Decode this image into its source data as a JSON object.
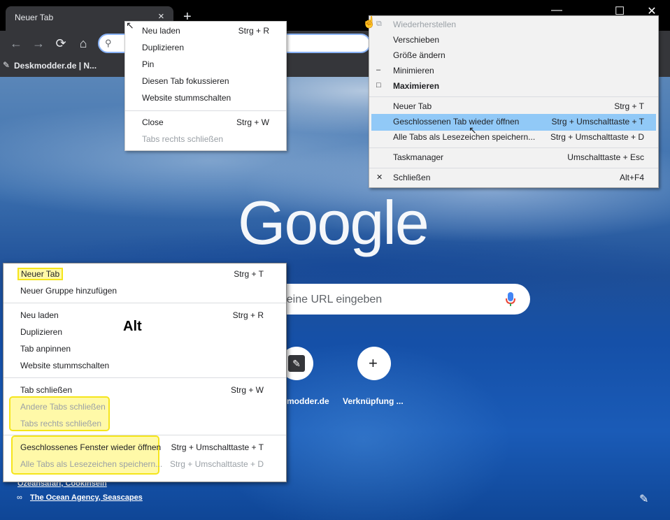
{
  "tab": {
    "title": "Neuer Tab",
    "close": "×",
    "new_tab": "+"
  },
  "window_controls": {
    "minimize": "—",
    "maximize": "☐",
    "close": "✕"
  },
  "toolbar": {
    "back": "←",
    "forward": "→",
    "reload": "⟳",
    "home": "⌂",
    "search_icon": "⚲"
  },
  "bookmarks": {
    "item": "Deskmodder.de | N..."
  },
  "google": {
    "logo": "Google",
    "search_placeholder": "r eine URL eingeben",
    "shortcut1_label": "modder.de",
    "shortcut2_label": "Verknüpfung ...",
    "shortcut2_icon": "+",
    "attribution1": "Ozeansafari, Cookinseln",
    "attribution2": "The Ocean Agency, Seascapes"
  },
  "tab_context_menu": {
    "items": [
      {
        "label": "Neu laden",
        "shortcut": "Strg + R"
      },
      {
        "label": "Duplizieren",
        "shortcut": ""
      },
      {
        "label": "Pin",
        "shortcut": ""
      },
      {
        "label": "Diesen Tab fokussieren",
        "shortcut": ""
      },
      {
        "label": "Website stummschalten",
        "shortcut": ""
      },
      {
        "label": "Close",
        "shortcut": "Strg + W"
      },
      {
        "label": "Tabs rechts schließen",
        "shortcut": ""
      }
    ]
  },
  "system_menu": {
    "items": [
      {
        "label": "Wiederherstellen",
        "shortcut": "",
        "icon": "⧉"
      },
      {
        "label": "Verschieben",
        "shortcut": ""
      },
      {
        "label": "Größe ändern",
        "shortcut": ""
      },
      {
        "label": "Minimieren",
        "shortcut": "",
        "icon": "‒"
      },
      {
        "label": "Maximieren",
        "shortcut": "",
        "icon": "□"
      },
      {
        "label": "Neuer Tab",
        "shortcut": "Strg + T"
      },
      {
        "label": "Geschlossenen Tab wieder öffnen",
        "shortcut": "Strg + Umschalttaste + T"
      },
      {
        "label": "Alle Tabs als Lesezeichen speichern...",
        "shortcut": "Strg + Umschalttaste + D"
      },
      {
        "label": "Taskmanager",
        "shortcut": "Umschalttaste + Esc"
      },
      {
        "label": "Schließen",
        "shortcut": "Alt+F4",
        "icon": "✕"
      }
    ]
  },
  "old_menu": {
    "items": [
      {
        "label": "Neuer Tab",
        "shortcut": "Strg + T"
      },
      {
        "label": "Neuer Gruppe hinzufügen",
        "shortcut": ""
      },
      {
        "label": "Neu laden",
        "shortcut": "Strg + R"
      },
      {
        "label": "Duplizieren",
        "shortcut": ""
      },
      {
        "label": "Tab anpinnen",
        "shortcut": ""
      },
      {
        "label": "Website stummschalten",
        "shortcut": ""
      },
      {
        "label": "Tab schließen",
        "shortcut": "Strg + W"
      },
      {
        "label": "Andere Tabs schließen",
        "shortcut": ""
      },
      {
        "label": "Tabs rechts schließen",
        "shortcut": ""
      },
      {
        "label": "Geschlossenes Fenster wieder öffnen",
        "shortcut": "Strg + Umschalttaste + T"
      },
      {
        "label": "Alle Tabs als Lesezeichen speichern...",
        "shortcut": "Strg + Umschalttaste + D"
      }
    ],
    "annotation": "Alt"
  },
  "colors": {
    "highlight": "#f5e51b",
    "selected": "#91c9f7",
    "chrome_dark": "#35363a"
  }
}
